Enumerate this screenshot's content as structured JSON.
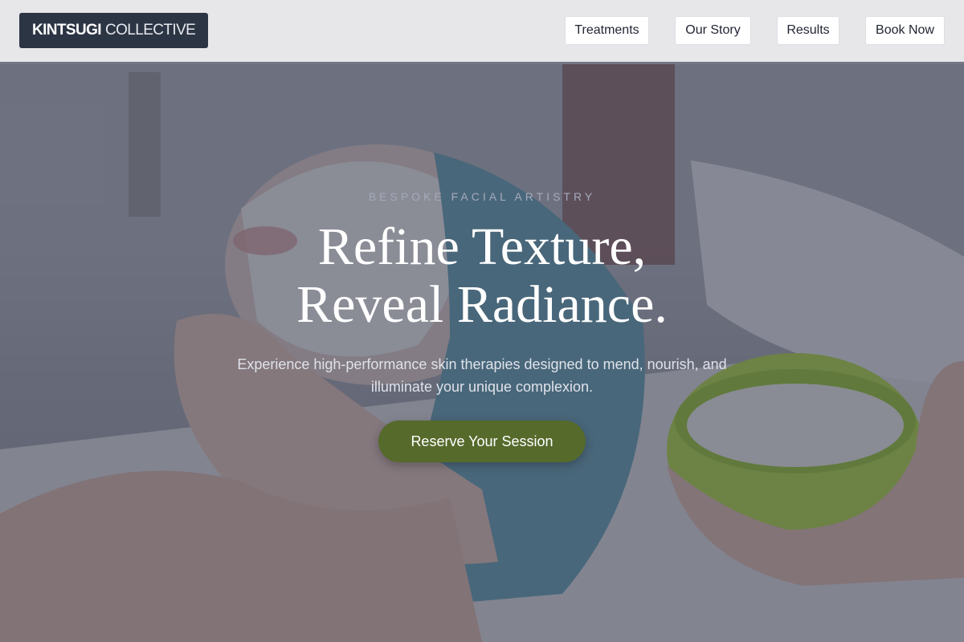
{
  "brand": {
    "name_bold": "KINTSUGI",
    "name_light": "COLLECTIVE"
  },
  "nav": {
    "items": [
      {
        "label": "Treatments"
      },
      {
        "label": "Our Story"
      },
      {
        "label": "Results"
      },
      {
        "label": "Book Now"
      }
    ]
  },
  "hero": {
    "eyebrow": "BESPOKE FACIAL ARTISTRY",
    "headline_line1": "Refine Texture,",
    "headline_line2": "Reveal Radiance.",
    "subtext": "Experience high-performance skin therapies designed to mend, nourish, and illuminate your unique complexion.",
    "cta_label": "Reserve Your Session"
  },
  "colors": {
    "logo_bg": "#2c3544",
    "cta_bg": "#566a2c",
    "overlay": "#282c42"
  }
}
